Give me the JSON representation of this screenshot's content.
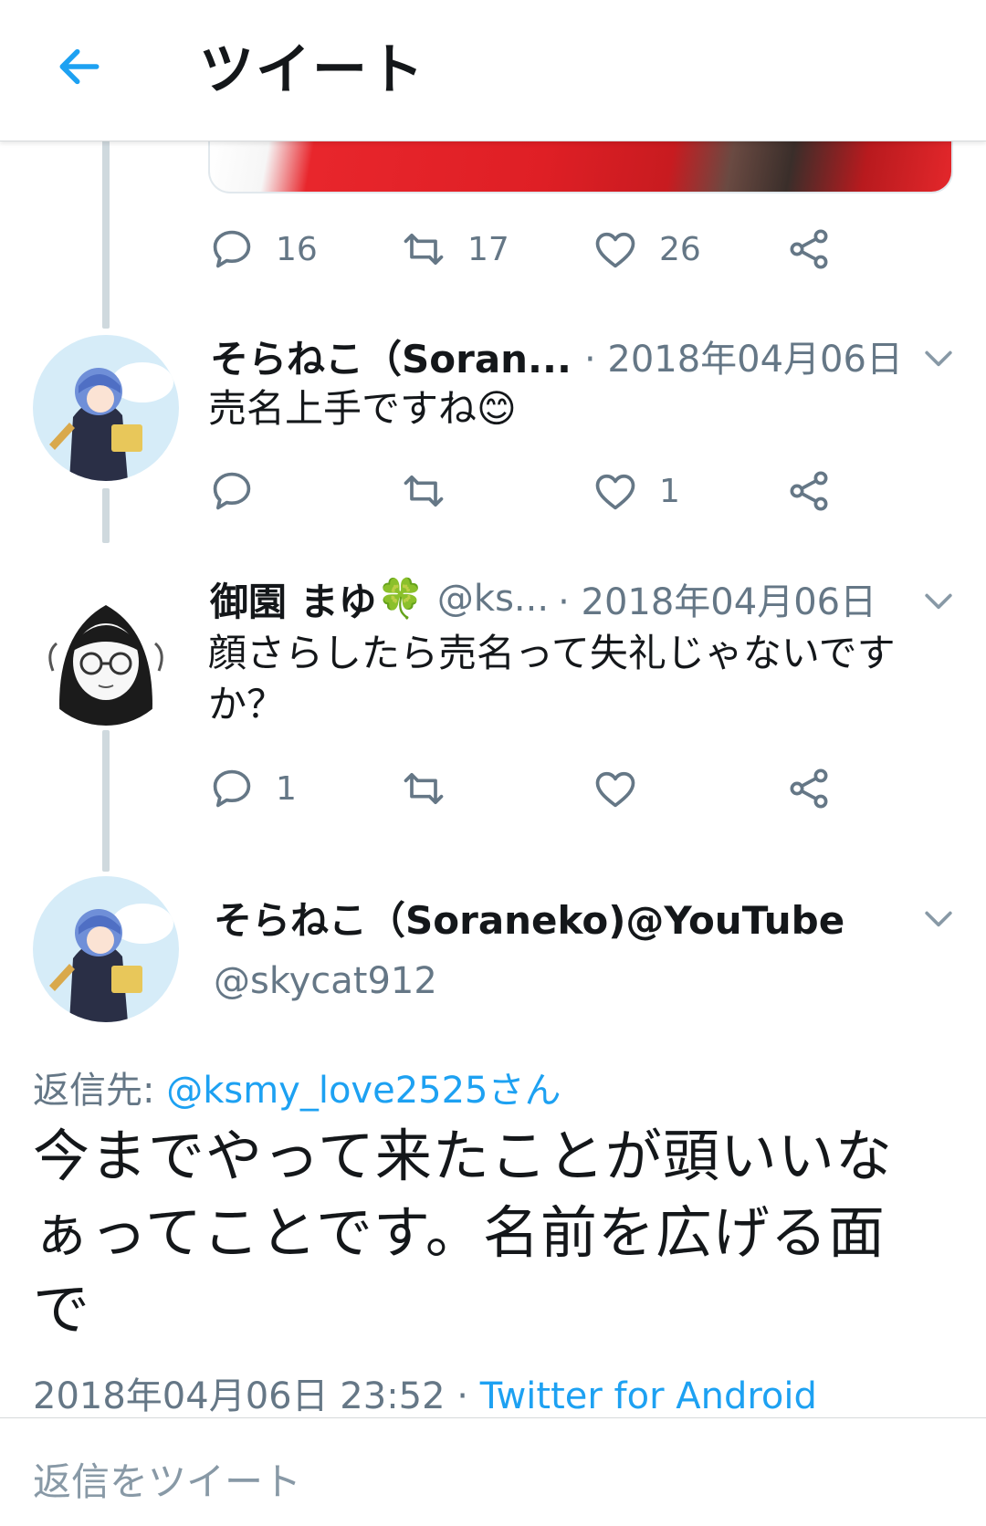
{
  "header": {
    "title": "ツイート"
  },
  "previous_tweet_actions": {
    "replies": "16",
    "retweets": "17",
    "likes": "26"
  },
  "tweets": [
    {
      "name": "そらねこ（Soran...",
      "handle": "",
      "date": "· 2018年04月06日",
      "text": "売名上手ですね",
      "emoji": "😊",
      "replies": "",
      "retweets": "",
      "likes": "1"
    },
    {
      "name": "御園 まゆ",
      "emoji": "🍀",
      "handle": "@ks...",
      "date": "· 2018年04月06日",
      "text_line1": "顔さらしたら売名って失礼じゃないです",
      "text_line2": "か？",
      "replies": "1",
      "retweets": "",
      "likes": ""
    }
  ],
  "main_tweet": {
    "name": "そらねこ（Soraneko)@YouTube",
    "handle": "@skycat912",
    "reply_label": "返信先: ",
    "reply_to": "@ksmy_love2525さん",
    "text_line1": "今までやって来たことが頭いいな",
    "text_line2": "ぁってことです。名前を広げる面",
    "text_line3": "で",
    "timestamp": "2018年04月06日 23:52",
    "separator": " · ",
    "source": "Twitter for Android"
  },
  "reply_box": {
    "placeholder": "返信をツイート"
  },
  "colors": {
    "accent": "#1da1f2",
    "secondary_text": "#657786",
    "thread_line": "#cfd9de"
  }
}
